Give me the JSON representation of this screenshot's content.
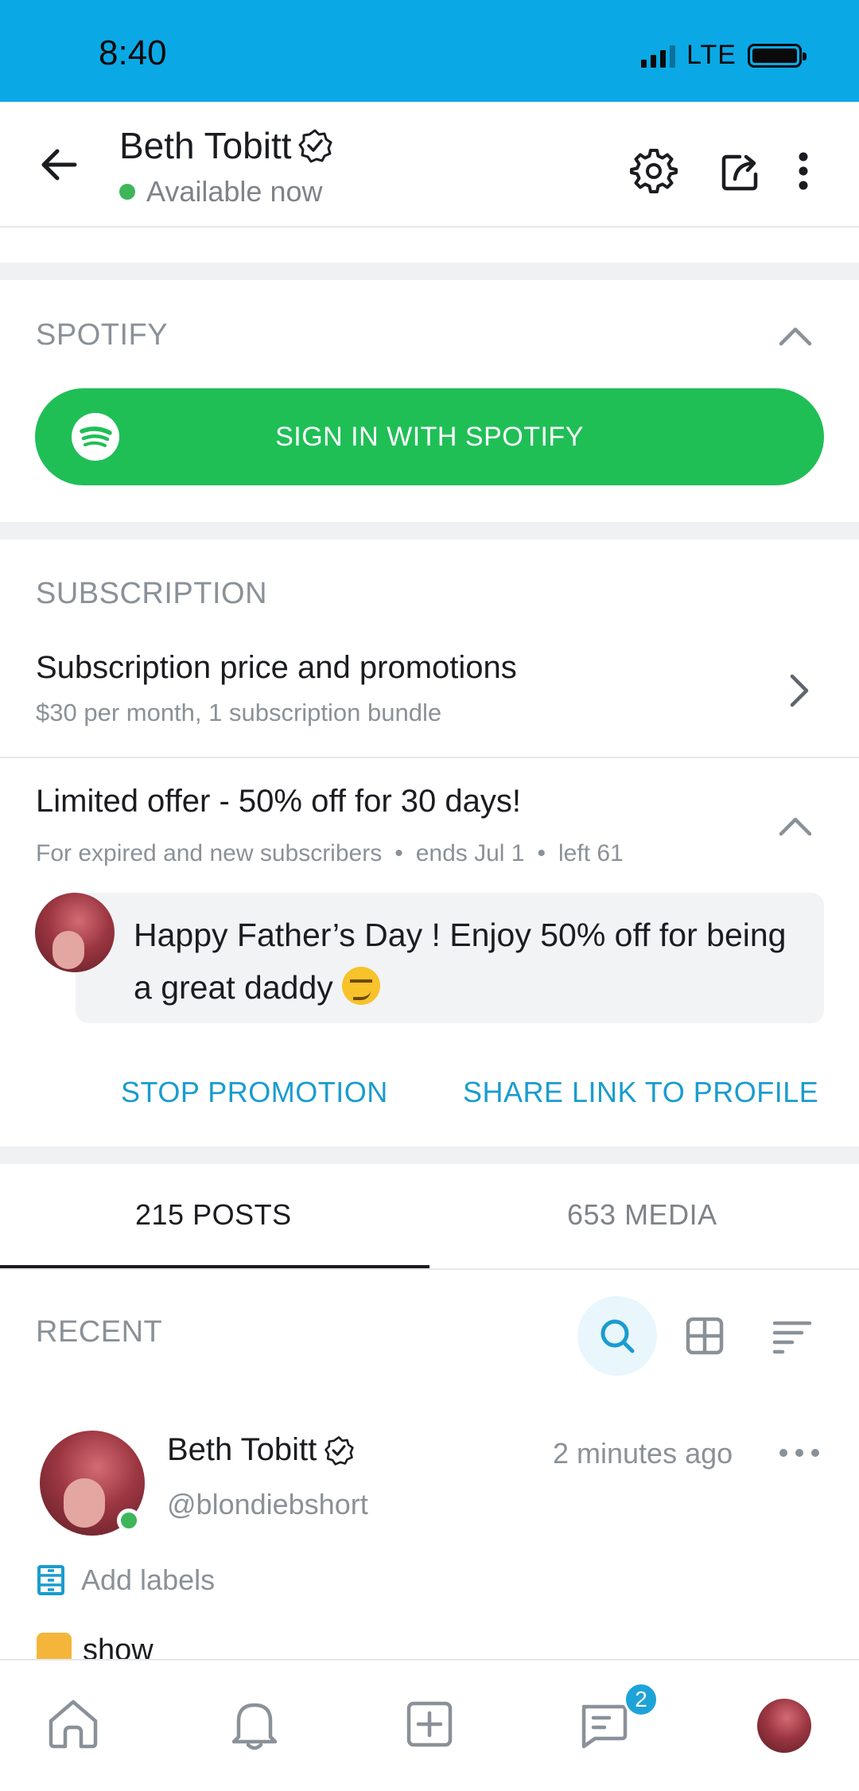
{
  "status_bar": {
    "time": "8:40",
    "network": "LTE",
    "background_color": "#0ba8e6"
  },
  "header": {
    "name": "Beth Tobitt",
    "availability": "Available now",
    "icons": [
      "back-arrow-icon",
      "verified-badge-icon",
      "gear-icon",
      "share-icon",
      "more-vertical-icon"
    ]
  },
  "spotify": {
    "section_title": "SPOTIFY",
    "button_label": "SIGN IN WITH SPOTIFY",
    "button_color": "#1fbf56"
  },
  "subscription": {
    "section_title": "SUBSCRIPTION",
    "row_title": "Subscription price and promotions",
    "row_subtitle": "$30 per month, 1 subscription bundle"
  },
  "offer": {
    "title": "Limited offer - 50% off for 30 days!",
    "meta": [
      "For expired and new subscribers",
      "ends Jul 1",
      "left 61"
    ],
    "separator": "•",
    "message": "Happy Father’s Day ! Enjoy 50% off for being a great daddy",
    "stop_label": "STOP PROMOTION",
    "share_label": "SHARE LINK TO PROFILE",
    "link_color": "#1a9ccf"
  },
  "tabs": [
    {
      "label": "215 POSTS",
      "active": true
    },
    {
      "label": "653 MEDIA",
      "active": false
    }
  ],
  "recent": {
    "label": "RECENT"
  },
  "post": {
    "author": "Beth Tobitt",
    "handle": "@blondiebshort",
    "time": "2 minutes ago",
    "labels_text": "Add labels",
    "text": "show"
  },
  "bottom_nav": {
    "items": [
      "home-icon",
      "bell-icon",
      "add-icon",
      "messages-icon",
      "profile-avatar"
    ],
    "messages_badge": "2"
  }
}
